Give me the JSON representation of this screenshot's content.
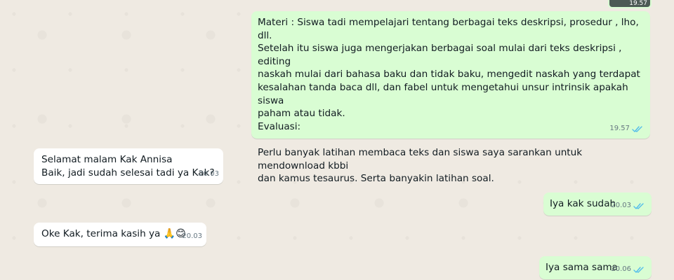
{
  "messages": [
    {
      "id": "m1",
      "direction": "outgoing",
      "text": "Materi : Siswa tadi mempelajari tentang berbagai teks deskripsi, prosedur , lho, dll.\nSetelah itu siswa juga mengerjakan berbagai soal mulai dari teks deskripsi , editing\nnaskah mulai dari bahasa baku dan tidak baku, mengedit naskah yang terdapat\nkesalahan tanda baca dll, dan fabel untuk mengetahui unsur intrinsik apakah siswa\npaham atau tidak.\nEvaluasi:\n\nPerlu banyak latihan membaca teks dan siswa saya sarankan untuk mendownload kbbi\ndan kamus tesaurus. Serta banyakin latihan soal.",
      "time": "19.57",
      "status": "read"
    },
    {
      "id": "m2",
      "direction": "incoming",
      "text": "Selamat malam Kak Annisa\nBaik, jadi sudah selesai tadi ya Kak?",
      "time": "20.03"
    },
    {
      "id": "m3",
      "direction": "outgoing",
      "text": "Iya kak sudah",
      "time": "20.03",
      "status": "read"
    },
    {
      "id": "m4",
      "direction": "incoming",
      "text": "Oke Kak, terima kasih ya ",
      "emojis": "🙏😊",
      "time": "20.03"
    },
    {
      "id": "m5",
      "direction": "outgoing",
      "text": "Iya sama sama",
      "time": "20.06",
      "status": "read"
    }
  ],
  "media_preview": {
    "time": "19.57"
  },
  "colors": {
    "background": "#efeae2",
    "outgoing_bubble": "#d9fdd3",
    "incoming_bubble": "#ffffff",
    "read_ticks": "#53bdeb",
    "timestamp": "#667781"
  },
  "icons": {
    "read_status": "double-check-icon"
  }
}
